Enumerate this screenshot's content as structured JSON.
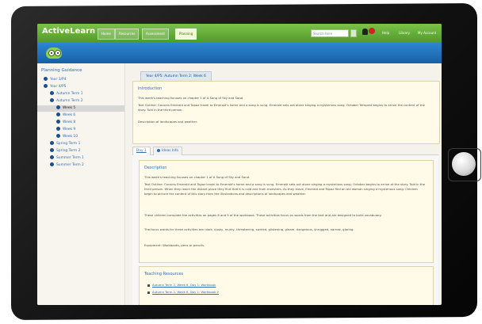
{
  "app": {
    "logo": "ActiveLearn"
  },
  "topnav": {
    "tabs": [
      "Home",
      "Resources",
      "Assessment",
      "Planning"
    ],
    "search_placeholder": "Search here",
    "notification_count": "",
    "links": [
      "Help",
      "Library",
      "My Account"
    ]
  },
  "sidebar": {
    "title": "Planning Guidance",
    "items": [
      "Year 3/P4",
      "Year 4/P5",
      "Autumn Term 1",
      "Autumn Term 2",
      "Week 5",
      "Week 6",
      "Week 8",
      "Week 9",
      "Week 10",
      "Spring Term 1",
      "Spring Term 2",
      "Summer Term 1",
      "Summer Term 2"
    ]
  },
  "main": {
    "breadcrumb": "Year 4/P5: Autumn Term 2: Week 6",
    "intro": {
      "heading": "Introduction",
      "line1": "This week's teaching focuses on chapter 1 of A Song of Sky and Sand.",
      "line2": "Text Outline: Cousins Emerald and Topaz travel to Emerald's home and a song is sung. Emerald sets out alone singing a mysterious song. October Tempest begins to arrive the content of the story. Told in the third person.",
      "line3": "Description of landscapes and weather."
    },
    "tabs": [
      "Day 1",
      "Ideas Info"
    ],
    "description": {
      "heading": "Description",
      "p1": "This week's teaching focuses on chapter 1 of A Song of Sky and Sand.",
      "p2": "Text Outline: Cousins Emerald and Topaz travel to Emerald's home and a song is sung. Emerald sets out alone singing a mysterious song; October begins to arrive at the story. Told in the third person. When they reach the distant place they find that it is cold and from monsters. As they leave, Emerald and Topaz find an old woman singing a mysterious song. Children begin to picture the content of this story from the illustrations and descriptions of landscapes and weather.",
      "p3": "These children complete the activities on pages 8 and 9 of the workbook. These activities focus on words from the text and are designed to build vocabulary.",
      "p4": "The focus words for these activities are: dark, dusky, murky, threatening, swirled, glistening, gleam, dangerous, shrugged, narrow, glaring.",
      "p5": "Equipment: Workbooks, pens or pencils."
    },
    "resources": {
      "heading": "Teaching Resources",
      "links": [
        "Autumn Term 2, Week 6, Day 1: Workbook",
        "Autumn Term 2, Week 6, Day 1: Workbook 2"
      ]
    }
  }
}
